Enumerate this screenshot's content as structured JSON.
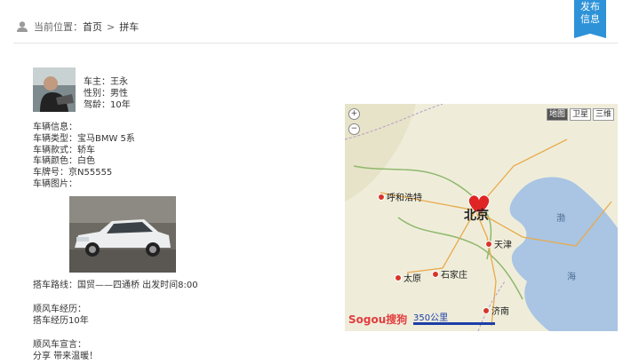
{
  "breadcrumb": {
    "prefix": "当前位置：",
    "home": "首页",
    "separator": ">",
    "current": "拼车"
  },
  "publish_button": {
    "line1": "发布",
    "line2": "信息"
  },
  "owner": {
    "name": "车主：王永",
    "gender": "性别：男性",
    "driving_age": "驾龄：10年"
  },
  "vehicle": {
    "heading": "车辆信息：",
    "type": "车辆类型：宝马BMW 5系",
    "style": "车辆款式：轿车",
    "color": "车辆颜色：白色",
    "plate": "车牌号：京N55555",
    "photo_label": "车辆图片："
  },
  "route": "搭车路线：国贸——四通桥 出发时间8:00",
  "experience": {
    "heading": "顺风车经历：",
    "text": "搭车经历10年"
  },
  "declaration": {
    "heading": "顺风车宣言：",
    "text": "分享 带来温暖！"
  },
  "map": {
    "tabs": [
      "地图",
      "卫星",
      "三维"
    ],
    "active_tab": "地图",
    "zoom_in": "+",
    "zoom_out": "−",
    "cities": {
      "hohhot": "呼和浩特",
      "beijing": "北京",
      "tianjin": "天津",
      "taiyuan": "太原",
      "shijiazhuang": "石家庄",
      "jinan": "济南",
      "bohai1": "渤",
      "bohai2": "海"
    },
    "scale": "350公里",
    "logo": "Sogou搜狗"
  }
}
